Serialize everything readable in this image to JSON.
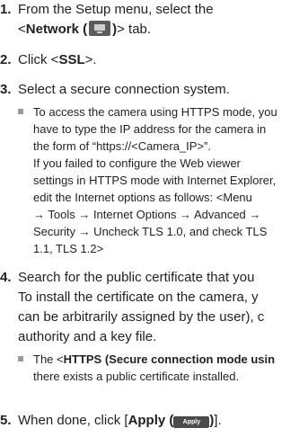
{
  "steps": [
    {
      "num": "1.",
      "line1": "From the Setup menu, select the",
      "pre": "<",
      "bold": "Network (",
      "icon": "network-monitor-icon",
      "bold_close": ")",
      "post": "> tab."
    },
    {
      "num": "2.",
      "pre": "Click <",
      "bold": "SSL",
      "post": ">."
    },
    {
      "num": "3.",
      "text": "Select a secure connection system."
    },
    {
      "num": "4.",
      "lines": [
        "Search for the public certificate that you",
        "To install the certificate on the camera, y",
        "can be arbitrarily assigned by the user), c",
        "authority and a key file."
      ]
    },
    {
      "num": "5.",
      "pre": "When done, click [",
      "bold": "Apply (",
      "button_label": "Apply",
      "bold_close": ")",
      "post": "]."
    }
  ],
  "note3": {
    "lines": [
      "To access the camera using HTTPS mode, you",
      "have to type the IP address for the camera in",
      "the form of “https://<Camera_IP>”.",
      "If you failed to configure the Web viewer",
      "settings in HTTPS mode with Internet Explorer,",
      "edit the Internet options as follows: <Menu",
      "→ Tools → Internet Options → Advanced →",
      "Security → Uncheck TLS 1.0, and check TLS",
      "1.1, TLS 1.2>"
    ]
  },
  "note4": {
    "pre": "The <",
    "bold": "HTTPS (Secure connection mode usin",
    "line2": "there exists a public certificate installed."
  }
}
